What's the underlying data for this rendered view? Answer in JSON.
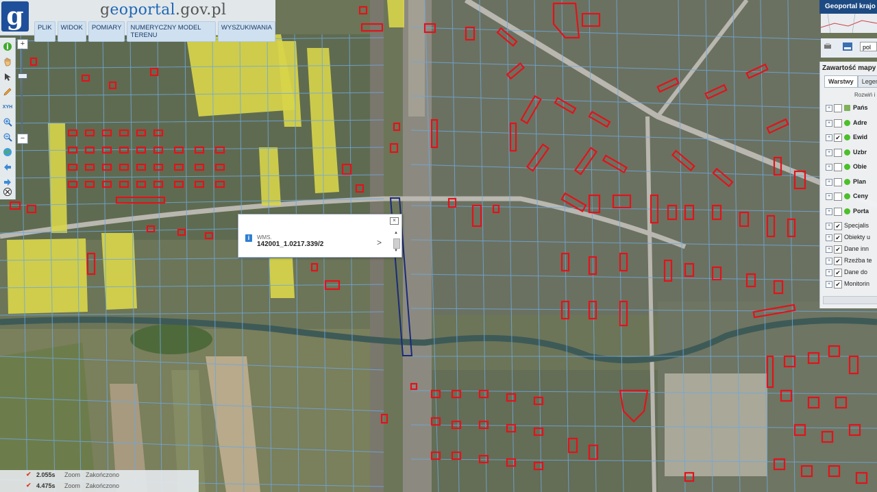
{
  "header": {
    "logo_glyph": "g",
    "site_title_prefix": "g",
    "site_title_accent": "eoportal",
    "site_title_suffix": ".gov.pl",
    "menu": [
      "PLIK",
      "WIDOK",
      "POMIARY",
      "NUMERYCZNY MODEL TERENU",
      "WYSZUKIWANIA"
    ]
  },
  "toolbar": {
    "tools": [
      "info-icon",
      "pan-hand-icon",
      "select-arrow-icon",
      "pencil-icon",
      "xyz-icon",
      "zoom-in-icon",
      "zoom-out-icon",
      "globe-icon",
      "back-arrow-icon",
      "forward-arrow-icon",
      "clear-icon"
    ],
    "xyz_label": "XYH"
  },
  "zoom": {
    "plus": "+",
    "minus": "−"
  },
  "popup": {
    "source": "WMS.",
    "value": "142001_1.0217.339/2",
    "info": "i",
    "close": "×",
    "arrow": ">"
  },
  "right_panel": {
    "header": "Geoportal krajo",
    "lang": "pol",
    "layers_title": "Zawartość mapy",
    "tabs": [
      "Warstwy",
      "Legen"
    ],
    "expand": "Rozwiń i",
    "layers": [
      {
        "label": "Pańs",
        "checked": false,
        "dot": false,
        "bold": true
      },
      {
        "label": "Adre",
        "checked": false,
        "dot": true,
        "bold": true
      },
      {
        "label": "Ewid",
        "checked": true,
        "dot": true,
        "bold": true
      },
      {
        "label": "Uzbr",
        "checked": false,
        "dot": true,
        "bold": true
      },
      {
        "label": "Obie",
        "checked": false,
        "dot": true,
        "bold": true
      },
      {
        "label": "Plan",
        "checked": false,
        "dot": true,
        "bold": true
      },
      {
        "label": "Ceny",
        "checked": false,
        "dot": true,
        "bold": true
      },
      {
        "label": "Porta",
        "checked": false,
        "dot": true,
        "bold": true
      },
      {
        "label": "Specjalis",
        "checked": true,
        "dot": false,
        "bold": false
      },
      {
        "label": "Obiekty u",
        "checked": true,
        "dot": false,
        "bold": false
      },
      {
        "label": "Dane inn",
        "checked": true,
        "dot": false,
        "bold": false
      },
      {
        "label": "Rzeźba te",
        "checked": true,
        "dot": false,
        "bold": false
      },
      {
        "label": "Dane do",
        "checked": true,
        "dot": false,
        "bold": false
      },
      {
        "label": "Monitorin",
        "checked": true,
        "dot": false,
        "bold": false
      }
    ]
  },
  "status": [
    {
      "time": "2.055s",
      "action": "Zoom",
      "state": "Zakończono"
    },
    {
      "time": "4.475s",
      "action": "Zoom",
      "state": "Zakończono"
    }
  ],
  "colors": {
    "parcel_line": "#6ea8e0",
    "building_outline": "#e3121b",
    "highlight_parcel": "#1a2a7a",
    "field_yellow": "#d8d54a"
  }
}
